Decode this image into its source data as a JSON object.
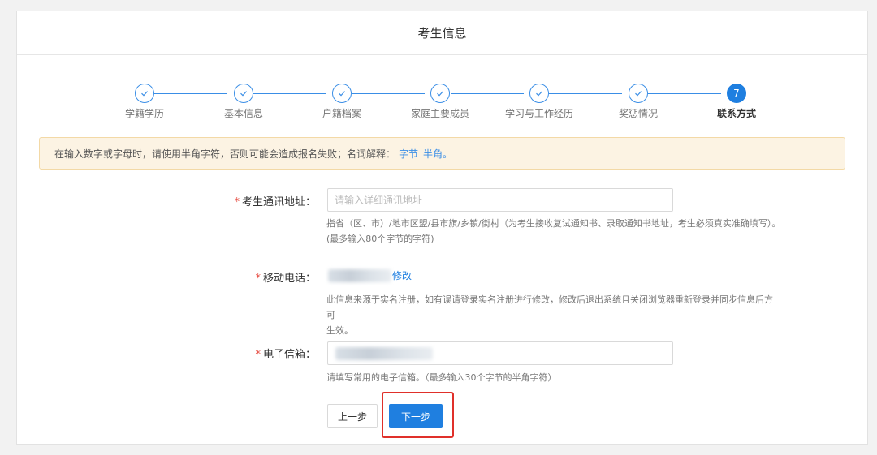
{
  "header": {
    "title": "考生信息"
  },
  "steps": [
    {
      "label": "学籍学历",
      "state": "done"
    },
    {
      "label": "基本信息",
      "state": "done"
    },
    {
      "label": "户籍档案",
      "state": "done"
    },
    {
      "label": "家庭主要成员",
      "state": "done"
    },
    {
      "label": "学习与工作经历",
      "state": "done"
    },
    {
      "label": "奖惩情况",
      "state": "done"
    },
    {
      "label": "联系方式",
      "state": "active",
      "number": "7"
    }
  ],
  "notice": {
    "text": "在输入数字或字母时，请使用半角字符，否则可能会造成报名失败；名词解释：",
    "link1": "字节",
    "link2": "半角。"
  },
  "form": {
    "address": {
      "required_mark": "*",
      "label": "考生通讯地址：",
      "placeholder": "请输入详细通讯地址",
      "value": "",
      "hint_line1": "指省（区、市）/地市区盟/县市旗/乡镇/街村（为考生接收复试通知书、录取通知书地址，考生必须真实准确填写）。",
      "hint_line2": "(最多输入80个字节的字符)"
    },
    "phone": {
      "required_mark": "*",
      "label": "移动电话：",
      "modify_link": "修改",
      "hint_line1": "此信息来源于实名注册，如有误请登录实名注册进行修改，修改后退出系统且关闭浏览器重新登录并同步信息后方可",
      "hint_line2": "生效。"
    },
    "email": {
      "required_mark": "*",
      "label": "电子信箱：",
      "hint": "请填写常用的电子信箱。（最多输入30个字节的半角字符）"
    }
  },
  "buttons": {
    "prev": "上一步",
    "next": "下一步"
  },
  "colors": {
    "accent": "#1f7fe0",
    "notice_bg": "#fcf3e3",
    "required": "#e5453a",
    "highlight": "#e0302a"
  }
}
